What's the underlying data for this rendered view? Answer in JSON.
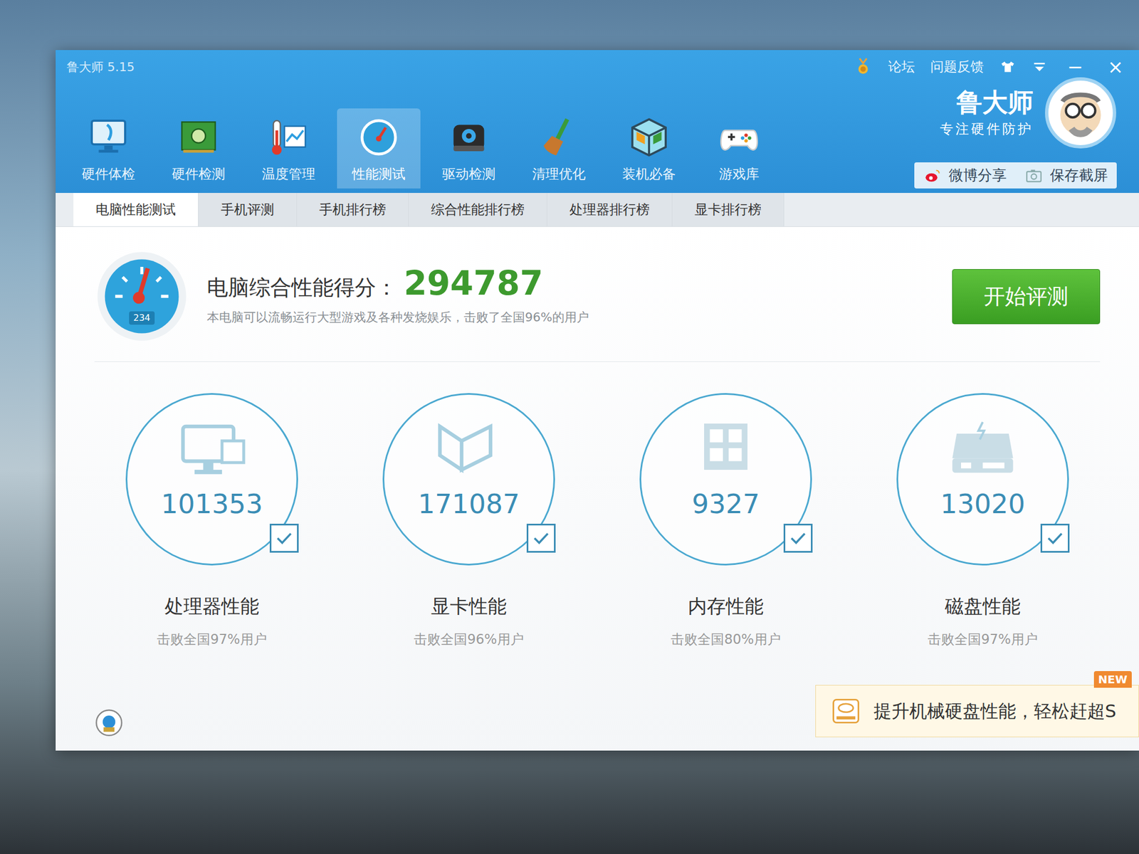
{
  "window": {
    "title": "鲁大师 5.15"
  },
  "top_links": [
    "论坛",
    "问题反馈"
  ],
  "window_controls": [
    "−",
    "×"
  ],
  "brand": {
    "name": "鲁大师",
    "slogan": "专注硬件防护"
  },
  "nav": [
    {
      "label": "硬件体检",
      "selected": false
    },
    {
      "label": "硬件检测",
      "selected": false
    },
    {
      "label": "温度管理",
      "selected": false
    },
    {
      "label": "性能测试",
      "selected": true
    },
    {
      "label": "驱动检测",
      "selected": false
    },
    {
      "label": "清理优化",
      "selected": false
    },
    {
      "label": "装机必备",
      "selected": false
    },
    {
      "label": "游戏库",
      "selected": false
    }
  ],
  "share": [
    "微博分享",
    "保存截屏"
  ],
  "tabs": [
    {
      "label": "电脑性能测试",
      "selected": true
    },
    {
      "label": "手机评测",
      "selected": false
    },
    {
      "label": "手机排行榜",
      "selected": false
    },
    {
      "label": "综合性能排行榜",
      "selected": false
    },
    {
      "label": "处理器排行榜",
      "selected": false
    },
    {
      "label": "显卡排行榜",
      "selected": false
    }
  ],
  "start_button": "开始评测",
  "score": {
    "label": "电脑综合性能得分：",
    "value": "294787",
    "gauge_text": "234",
    "description": "本电脑可以流畅运行大型游戏及各种发烧娱乐，击败了全国96%的用户"
  },
  "categories": [
    {
      "name": "处理器性能",
      "score": "101353",
      "rank": "击败全国97%用户",
      "checked": true
    },
    {
      "name": "显卡性能",
      "score": "171087",
      "rank": "击败全国96%用户",
      "checked": true
    },
    {
      "name": "内存性能",
      "score": "9327",
      "rank": "击败全国80%用户",
      "checked": true
    },
    {
      "name": "磁盘性能",
      "score": "13020",
      "rank": "击败全国97%用户",
      "checked": true
    }
  ],
  "banner": {
    "text": "提升机械硬盘性能，轻松赶超S",
    "badge": "NEW"
  }
}
